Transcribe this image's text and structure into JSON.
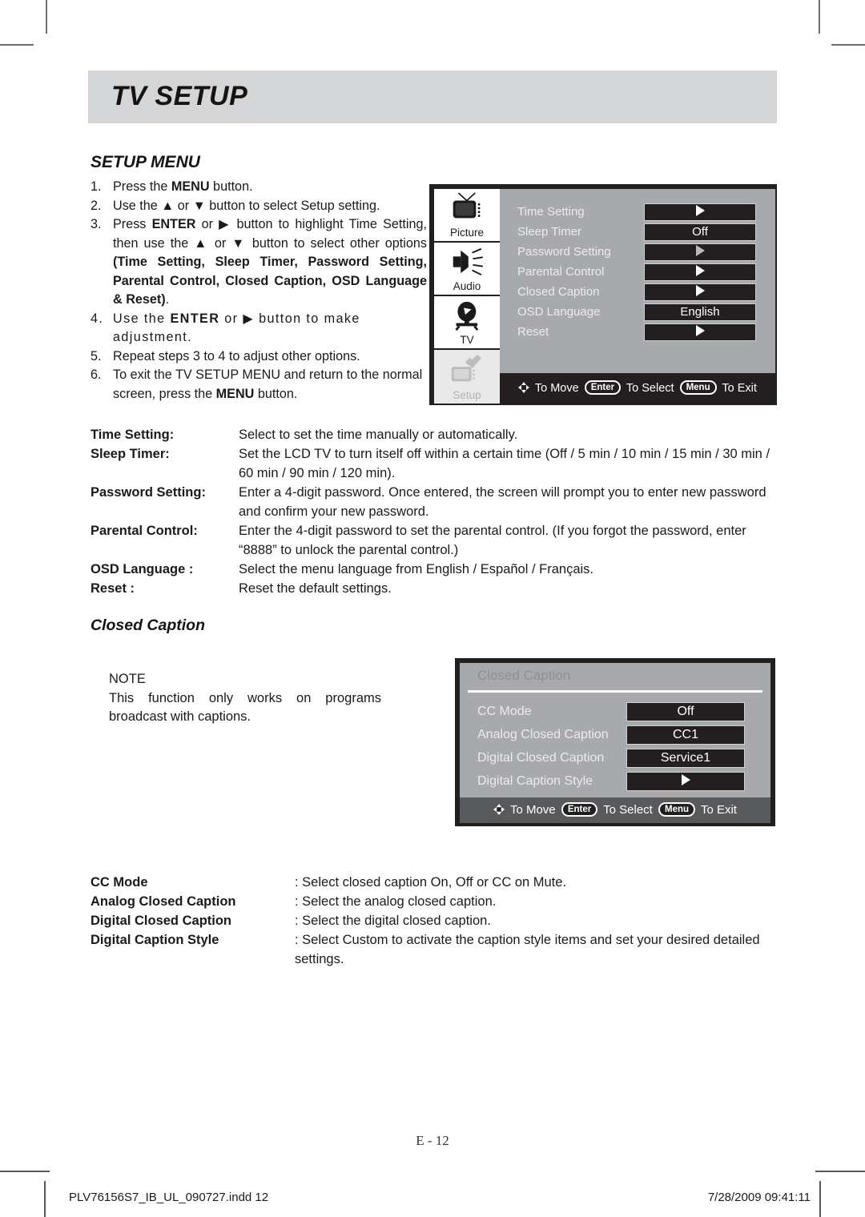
{
  "chapter": {
    "title": "TV SETUP"
  },
  "section": {
    "heading": "SETUP MENU"
  },
  "steps": [
    {
      "num": "1.",
      "html": "Press the <b>MENU</b> button."
    },
    {
      "num": "2.",
      "html": "Use the ▲ or ▼ button to select Setup setting."
    },
    {
      "num": "3.",
      "html": "Press <b>ENTER</b> or ▶ button to highlight Time Setting, then use the ▲ or ▼ button to select other options <b>(Time Setting, Sleep Timer, Password Setting, Parental Control, Closed Caption, OSD Language &amp; Reset)</b>."
    },
    {
      "num": "4.",
      "html": "Use the <b>ENTER</b> or ▶ button to make adjustment."
    },
    {
      "num": "5.",
      "html": "Repeat steps 3 to 4 to adjust other options."
    },
    {
      "num": "6.",
      "html": "To exit the TV SETUP MENU and return to the normal screen, press the <b>MENU</b> button."
    }
  ],
  "osd_setup": {
    "sidebar": [
      {
        "label": "Picture",
        "icon": "tv-antenna-icon",
        "selected": false
      },
      {
        "label": "Audio",
        "icon": "speaker-icon",
        "selected": false
      },
      {
        "label": "TV",
        "icon": "satellite-dish-icon",
        "selected": false
      },
      {
        "label": "Setup",
        "icon": "wrench-tv-icon",
        "selected": true
      }
    ],
    "rows": [
      {
        "label": "Time Setting",
        "value": "",
        "arrow": true,
        "arrow_dim": false
      },
      {
        "label": "Sleep Timer",
        "value": "Off",
        "arrow": false,
        "arrow_dim": false
      },
      {
        "label": "Password Setting",
        "value": "",
        "arrow": true,
        "arrow_dim": true
      },
      {
        "label": "Parental Control",
        "value": "",
        "arrow": true,
        "arrow_dim": false
      },
      {
        "label": "Closed Caption",
        "value": "",
        "arrow": true,
        "arrow_dim": false
      },
      {
        "label": "OSD Language",
        "value": "English",
        "arrow": false,
        "arrow_dim": false
      },
      {
        "label": "Reset",
        "value": "",
        "arrow": true,
        "arrow_dim": false
      }
    ],
    "footer": {
      "move_label": "To Move",
      "enter_key": "Enter",
      "select_label": "To Select",
      "menu_key": "Menu",
      "exit_label": "To Exit"
    }
  },
  "desc_setup": [
    {
      "term": "Time Setting:",
      "defn": "Select to set the time manually or automatically."
    },
    {
      "term": "Sleep Timer:",
      "defn": "Set the LCD TV to turn itself off within a certain time (Off / 5 min / 10 min / 15 min / 30 min / 60 min / 90 min / 120 min)."
    },
    {
      "term": "Password Setting:",
      "defn": "Enter a 4-digit password. Once entered, the screen will prompt you to enter new password and confirm your new password."
    },
    {
      "term": "Parental Control:",
      "defn": "Enter the 4-digit password to set the parental control. (If you forgot the password, enter “8888” to unlock the parental control.)"
    },
    {
      "term": "OSD Language :",
      "defn": "Select the menu language from English / Español / Français."
    },
    {
      "term": "Reset :",
      "defn": "Reset the default settings."
    }
  ],
  "cc_section": {
    "heading": "Closed Caption"
  },
  "cc_note": {
    "title": "NOTE",
    "body": "This function only works on programs broadcast with captions."
  },
  "osd_cc": {
    "title": "Closed Caption",
    "rows": [
      {
        "label": "CC Mode",
        "value": "Off",
        "arrow": false
      },
      {
        "label": "Analog Closed Caption",
        "value": "CC1",
        "arrow": false
      },
      {
        "label": "Digital Closed Caption",
        "value": "Service1",
        "arrow": false
      },
      {
        "label": "Digital Caption Style",
        "value": "",
        "arrow": true
      }
    ],
    "footer": {
      "move_label": "To Move",
      "enter_key": "Enter",
      "select_label": "To Select",
      "menu_key": "Menu",
      "exit_label": "To Exit"
    }
  },
  "desc_cc": [
    {
      "term": "CC Mode",
      "defn": ": Select closed caption On, Off or CC on Mute."
    },
    {
      "term": "Analog Closed Caption",
      "defn": ": Select the analog closed caption."
    },
    {
      "term": "Digital Closed Caption",
      "defn": ": Select the digital closed caption."
    },
    {
      "term": "Digital Caption Style",
      "defn": ": Select Custom to activate the caption style items and set your desired detailed settings."
    }
  ],
  "page_number": "E - 12",
  "footer": {
    "file": "PLV76156S7_IB_UL_090727.indd   12",
    "stamp": "7/28/2009   09:41:11"
  },
  "colors": {
    "chapter_bar": "#d4d5d7",
    "osd_panel": "#a7a9ac",
    "osd_frame": "#231f20",
    "osd_cc_footer": "#58595b",
    "text": "#1a1a1a"
  }
}
